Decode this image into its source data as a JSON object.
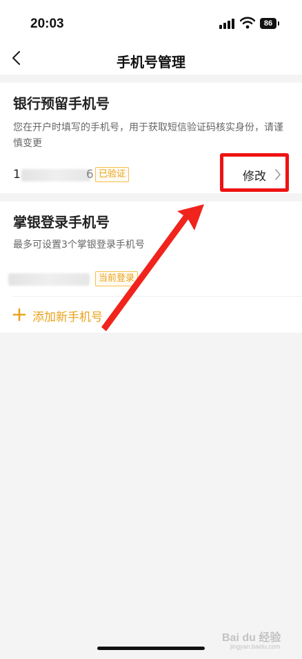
{
  "status_bar": {
    "time": "20:03",
    "battery": "86"
  },
  "nav": {
    "title": "手机号管理",
    "back_icon": "chevron-left-icon"
  },
  "bank_phone_section": {
    "title": "银行预留手机号",
    "description": "您在开户时填写的手机号，用于获取短信验证码核实身份，请谨慎变更",
    "phone_first_digit": "1",
    "phone_last_digit": "6",
    "verified_badge": "已验证",
    "modify_label": "修改"
  },
  "login_phone_section": {
    "title": "掌银登录手机号",
    "description": "最多可设置3个掌银登录手机号",
    "current_login_badge": "当前登录",
    "add_label": "添加新手机号"
  },
  "watermark": {
    "text": "Bai du 经验",
    "sub": "jingyan.baidu.com"
  },
  "colors": {
    "accent": "#e9a21b",
    "highlight_red": "#ee1212",
    "background": "#f4f4f4"
  }
}
